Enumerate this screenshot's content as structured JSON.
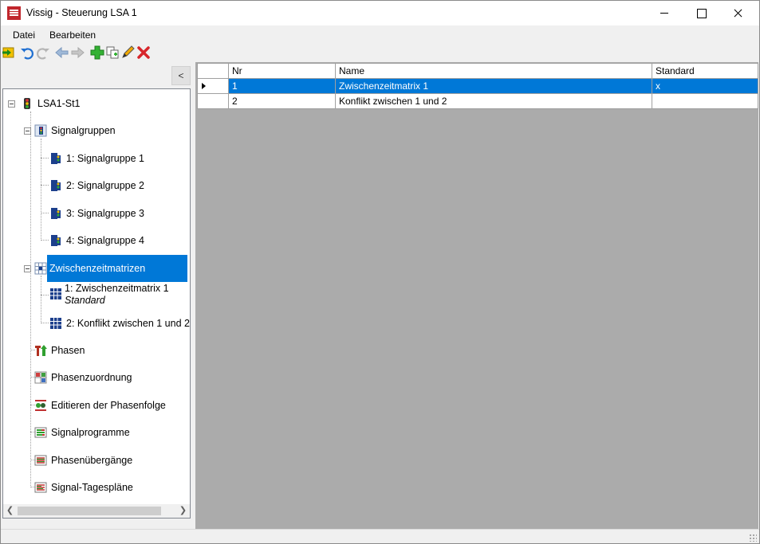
{
  "window": {
    "title": "Vissig - Steuerung LSA 1",
    "app_icon": "vissig-app-icon"
  },
  "menu": [
    "Datei",
    "Bearbeiten"
  ],
  "toolbar": {
    "icons": [
      "import-icon",
      "undo-icon",
      "redo-icon",
      "back-arrow-icon",
      "forward-arrow-icon",
      "add-icon",
      "copy-icon",
      "edit-pencil-icon",
      "delete-icon"
    ]
  },
  "left_panel": {
    "collapse_label": "<"
  },
  "tree": {
    "root": "LSA1-St1",
    "signalgruppen": "Signalgruppen",
    "signal_groups": [
      "1: Signalgruppe 1",
      "2: Signalgruppe 2",
      "3: Signalgruppe 3",
      "4: Signalgruppe 4"
    ],
    "zwischenzeitmatrizen": "Zwischenzeitmatrizen",
    "matrices": [
      {
        "label": "1: Zwischenzeitmatrix 1",
        "sub": "Standard"
      },
      {
        "label": "2: Konflikt zwischen 1 und 2",
        "sub": ""
      }
    ],
    "phasen": "Phasen",
    "phasenzuordnung": "Phasenzuordnung",
    "phasenfolge": "Editieren der Phasenfolge",
    "signalprogramme": "Signalprogramme",
    "phasenuebergaenge": "Phasenübergänge",
    "tagesplaene": "Signal-Tagespläne"
  },
  "grid": {
    "columns": [
      "Nr",
      "Name",
      "Standard"
    ],
    "rows": [
      {
        "nr": "1",
        "name": "Zwischenzeitmatrix 1",
        "standard": "x",
        "selected": true
      },
      {
        "nr": "2",
        "name": "Konflikt zwischen 1 und 2",
        "standard": "",
        "selected": false
      }
    ]
  },
  "colors": {
    "selection": "#0078d7",
    "grid_background": "#ababab",
    "app_icon_red": "#c1272d"
  }
}
